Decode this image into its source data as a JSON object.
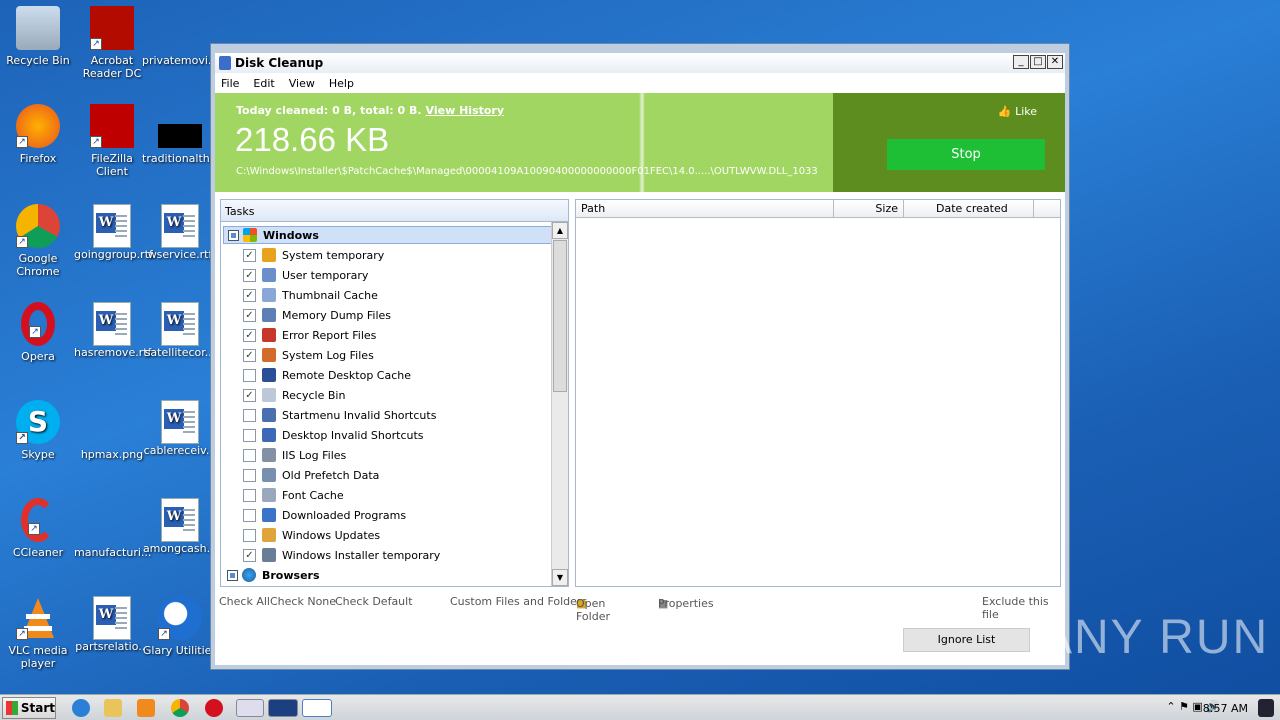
{
  "desktop": {
    "icons": [
      {
        "label": "Recycle Bin"
      },
      {
        "label": "Acrobat Reader DC"
      },
      {
        "label": "privatemovi..."
      },
      {
        "label": "Firefox"
      },
      {
        "label": "FileZilla Client"
      },
      {
        "label": "traditionalth..."
      },
      {
        "label": "Google Chrome"
      },
      {
        "label": "goinggroup.rtf"
      },
      {
        "label": "wservice.rtf"
      },
      {
        "label": "Opera"
      },
      {
        "label": "hasremove.rtf"
      },
      {
        "label": "satellitecor..."
      },
      {
        "label": "Skype"
      },
      {
        "label": "hpmax.png"
      },
      {
        "label": "cablereceiv..."
      },
      {
        "label": "CCleaner"
      },
      {
        "label": "manufacturi..."
      },
      {
        "label": "amongcash..."
      },
      {
        "label": "VLC media player"
      },
      {
        "label": "partsrelatio..."
      },
      {
        "label": "Glary Utilities"
      }
    ]
  },
  "window": {
    "title": "Disk Cleanup",
    "menu": [
      "File",
      "Edit",
      "View",
      "Help"
    ],
    "controls": {
      "minimize": "_",
      "maximize": "□",
      "close": "✕"
    }
  },
  "banner": {
    "today": "Today cleaned: 0 B, total: 0 B.",
    "history_link": "View History",
    "size": "218.66 KB",
    "path": "C:\\Windows\\Installer\\$PatchCache$\\Managed\\00004109A10090400000000000F01FEC\\14.0.....\\OUTLWVW.DLL_1033",
    "like": "Like",
    "stop": "Stop"
  },
  "tasks": {
    "header": "Tasks",
    "group_windows": "Windows",
    "group_browsers": "Browsers",
    "items": [
      {
        "label": "System temporary",
        "checked": true,
        "color": "#e8a21e"
      },
      {
        "label": "User temporary",
        "checked": true,
        "color": "#6a8fc9"
      },
      {
        "label": "Thumbnail Cache",
        "checked": true,
        "color": "#8aa7d8"
      },
      {
        "label": "Memory Dump Files",
        "checked": true,
        "color": "#5d7fb6"
      },
      {
        "label": "Error Report Files",
        "checked": true,
        "color": "#c7372c"
      },
      {
        "label": "System Log Files",
        "checked": true,
        "color": "#d36b2a"
      },
      {
        "label": "Remote Desktop Cache",
        "checked": false,
        "color": "#2a4f96"
      },
      {
        "label": "Recycle Bin",
        "checked": true,
        "color": "#bcc8d8"
      },
      {
        "label": "Startmenu Invalid Shortcuts",
        "checked": false,
        "color": "#4a6fb0"
      },
      {
        "label": "Desktop Invalid Shortcuts",
        "checked": false,
        "color": "#3d68b8"
      },
      {
        "label": "IIS Log Files",
        "checked": false,
        "color": "#8391a4"
      },
      {
        "label": "Old Prefetch Data",
        "checked": false,
        "color": "#7890ad"
      },
      {
        "label": "Font Cache",
        "checked": false,
        "color": "#9aa8bd"
      },
      {
        "label": "Downloaded Programs",
        "checked": false,
        "color": "#3b73c8"
      },
      {
        "label": "Windows Updates",
        "checked": false,
        "color": "#e0a53a"
      },
      {
        "label": "Windows Installer temporary",
        "checked": true,
        "color": "#6a7d96"
      }
    ]
  },
  "list": {
    "columns": [
      "Path",
      "Size",
      "Date created"
    ]
  },
  "bottom": {
    "check_all": "Check All",
    "check_none": "Check None",
    "check_default": "Check Default",
    "custom": "Custom Files and Folders",
    "open_folder": "Open Folder",
    "properties": "Properties",
    "exclude": "Exclude this file",
    "ignore_list": "Ignore List"
  },
  "taskbar": {
    "start": "Start",
    "clock": "8:57 AM"
  },
  "watermark": "ANY RUN"
}
